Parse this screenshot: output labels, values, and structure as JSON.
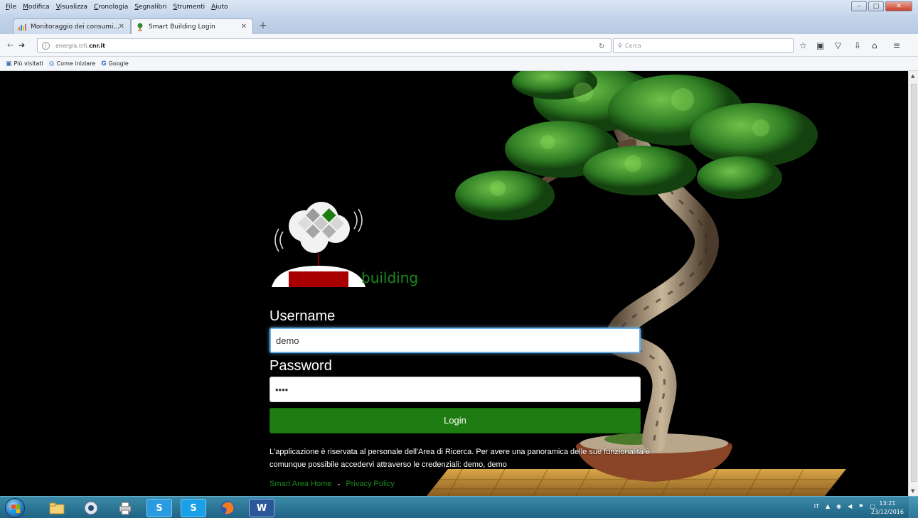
{
  "menu": [
    "File",
    "Modifica",
    "Visualizza",
    "Cronologia",
    "Segnalibri",
    "Strumenti",
    "Aiuto"
  ],
  "tabs": [
    {
      "label": "Monitoraggio dei consumi...",
      "icon": "chart-icon"
    },
    {
      "label": "Smart Building Login",
      "icon": "tree-icon"
    }
  ],
  "url": {
    "prefix": "energia.isti.",
    "domain": "cnr.it"
  },
  "search_placeholder": "Cerca",
  "bookmarks": [
    "Più visitati",
    "Come iniziare",
    "Google"
  ],
  "logo": {
    "smart": "SMART",
    "building": "building"
  },
  "form": {
    "username_label": "Username",
    "username_value": "demo",
    "password_label": "Password",
    "password_value": "demo",
    "login_label": "Login"
  },
  "notice": "L'applicazione è riservata al personale dell'Area di Ricerca. Per avere una panoramica delle sue funzionalità è comunque possibile accedervi attraverso le credenziali: demo, demo",
  "footer": {
    "home_link": "Smart Area Home",
    "separator": "-",
    "privacy_link": "Privacy Policy"
  },
  "taskbar": {
    "lang": "IT",
    "time": "13:21",
    "date": "23/12/2016"
  },
  "colors": {
    "accent_green": "#1e7d12",
    "brand_red": "#a80000",
    "brand_green": "#1c8a1c"
  }
}
